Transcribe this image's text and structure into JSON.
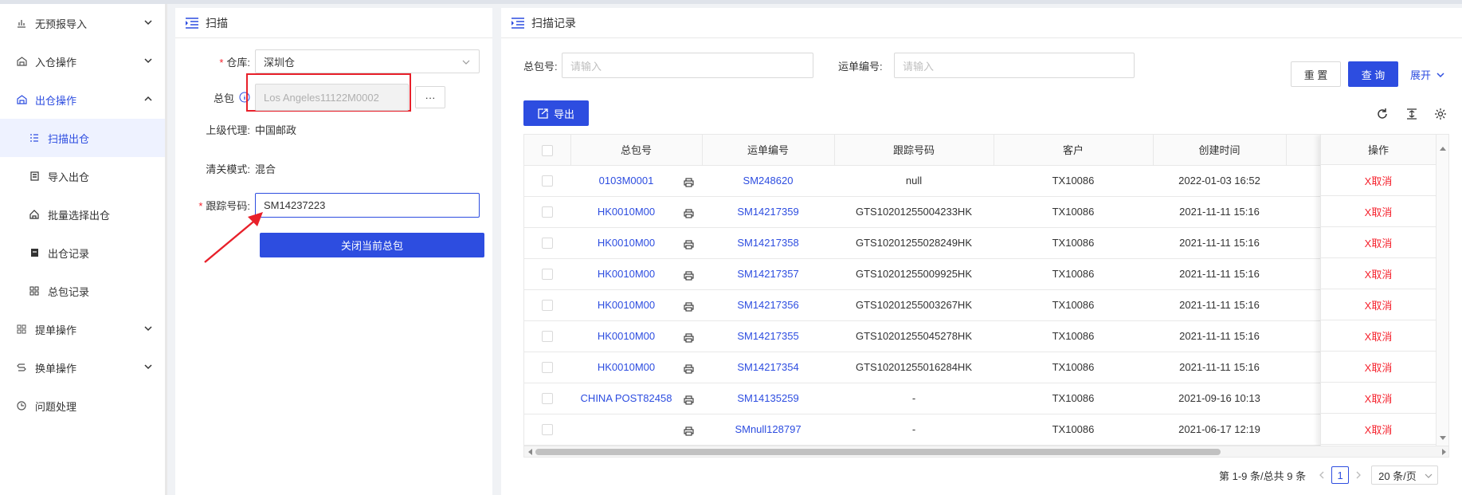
{
  "sidebar": {
    "items": [
      {
        "label": "无预报导入",
        "icon": "import-chart-icon",
        "expanded": false
      },
      {
        "label": "入仓操作",
        "icon": "warehouse-in-icon",
        "expanded": false
      },
      {
        "label": "出仓操作",
        "icon": "warehouse-out-icon",
        "expanded": true
      },
      {
        "label": "提单操作",
        "icon": "grid-icon",
        "expanded": false
      },
      {
        "label": "换单操作",
        "icon": "swap-icon",
        "expanded": false
      },
      {
        "label": "问题处理",
        "icon": "clock-icon"
      }
    ],
    "subitems": [
      {
        "label": "扫描出仓",
        "icon": "scan-list-icon"
      },
      {
        "label": "导入出仓",
        "icon": "import-doc-icon"
      },
      {
        "label": "批量选择出仓",
        "icon": "house-icon"
      },
      {
        "label": "出仓记录",
        "icon": "record-icon"
      },
      {
        "label": "总包记录",
        "icon": "package-grid-icon"
      }
    ]
  },
  "scan_panel": {
    "title": "扫描",
    "warehouse_label": "仓库:",
    "warehouse_value": "深圳仓",
    "package_label": "总包",
    "package_value": "Los Angeles11122M0002",
    "more_label": "···",
    "agent_label": "上级代理:",
    "agent_value": "中国邮政",
    "mode_label": "清关模式:",
    "mode_value": "混合",
    "tracking_label": "跟踪号码:",
    "tracking_value": "SM14237223",
    "close_button": "关闭当前总包"
  },
  "records_panel": {
    "title": "扫描记录",
    "package_no_label": "总包号:",
    "package_no_placeholder": "请输入",
    "waybill_label": "运单编号:",
    "waybill_placeholder": "请输入",
    "reset_button": "重 置",
    "query_button": "查 询",
    "expand_label": "展开",
    "export_button": "导出"
  },
  "table": {
    "columns": [
      "总包号",
      "运单编号",
      "跟踪号码",
      "客户",
      "创建时间",
      "操作"
    ],
    "rows": [
      {
        "package": "0103M0001",
        "waybill": "SM248620",
        "tracking": "null",
        "customer": "TX10086",
        "created": "2022-01-03 16:52",
        "action": "X取消"
      },
      {
        "package": "HK0010M00",
        "waybill": "SM14217359",
        "tracking": "GTS10201255004233HK",
        "customer": "TX10086",
        "created": "2021-11-11 15:16",
        "action": "X取消"
      },
      {
        "package": "HK0010M00",
        "waybill": "SM14217358",
        "tracking": "GTS10201255028249HK",
        "customer": "TX10086",
        "created": "2021-11-11 15:16",
        "action": "X取消"
      },
      {
        "package": "HK0010M00",
        "waybill": "SM14217357",
        "tracking": "GTS10201255009925HK",
        "customer": "TX10086",
        "created": "2021-11-11 15:16",
        "action": "X取消"
      },
      {
        "package": "HK0010M00",
        "waybill": "SM14217356",
        "tracking": "GTS10201255003267HK",
        "customer": "TX10086",
        "created": "2021-11-11 15:16",
        "action": "X取消"
      },
      {
        "package": "HK0010M00",
        "waybill": "SM14217355",
        "tracking": "GTS10201255045278HK",
        "customer": "TX10086",
        "created": "2021-11-11 15:16",
        "action": "X取消"
      },
      {
        "package": "HK0010M00",
        "waybill": "SM14217354",
        "tracking": "GTS10201255016284HK",
        "customer": "TX10086",
        "created": "2021-11-11 15:16",
        "action": "X取消"
      },
      {
        "package": "CHINA POST82458",
        "waybill": "SM14135259",
        "tracking": "-",
        "customer": "TX10086",
        "created": "2021-09-16 10:13",
        "action": "X取消"
      },
      {
        "package": "",
        "waybill": "SMnull128797",
        "tracking": "-",
        "customer": "TX10086",
        "created": "2021-06-17 12:19",
        "action": "X取消"
      }
    ]
  },
  "pagination": {
    "summary": "第 1-9 条/总共 9 条",
    "current_page": "1",
    "page_size": "20 条/页"
  },
  "colors": {
    "primary": "#2d4de0",
    "danger": "#f5222d",
    "highlight_box": "#e8202a"
  }
}
